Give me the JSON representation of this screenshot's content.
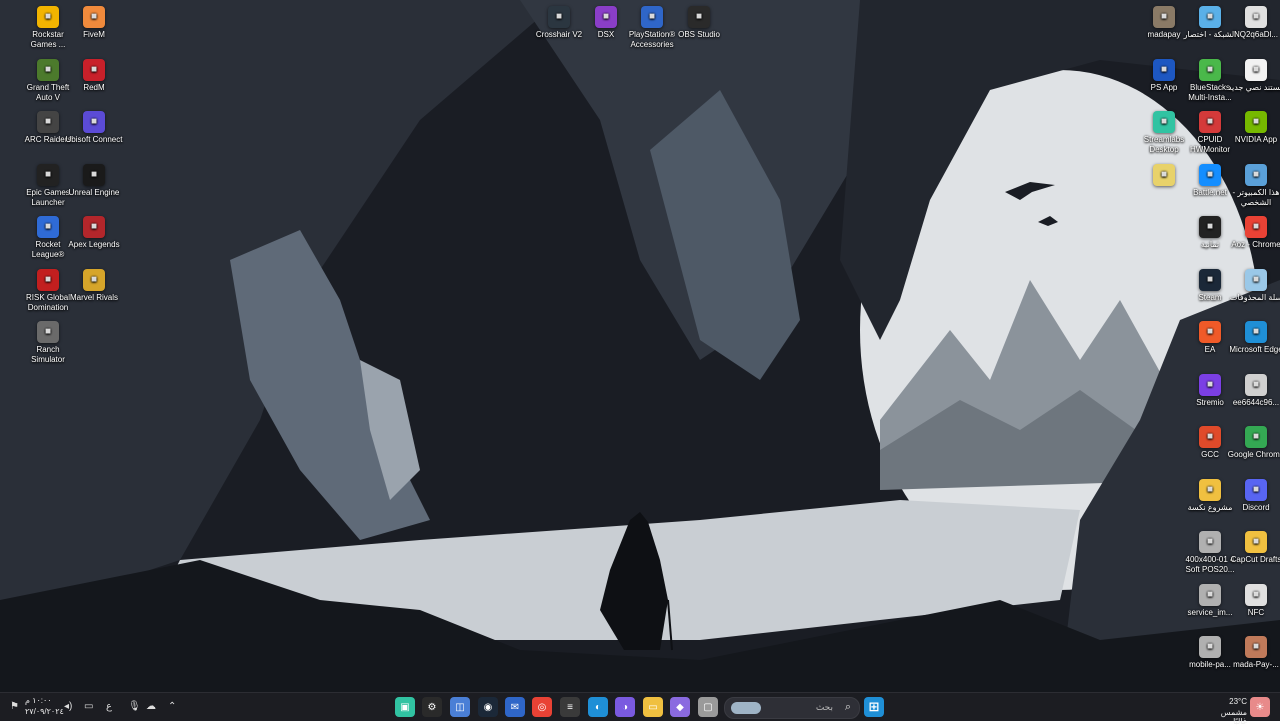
{
  "colors": {
    "taskbar": "#1c1d22",
    "sky": "#e6e8ea",
    "cave_dark": "#1a1d24"
  },
  "desktop_icons": [
    {
      "id": "rockstar",
      "label": "Rockstar Games ...",
      "icon": "rockstar-icon",
      "color": "#f2b400"
    },
    {
      "id": "fivem",
      "label": "FiveM",
      "icon": "fivem-icon",
      "color": "#f08a3c"
    },
    {
      "id": "gta",
      "label": "Grand Theft Auto V",
      "icon": "gta-icon",
      "color": "#4c7a2c"
    },
    {
      "id": "redm",
      "label": "RedM",
      "icon": "redm-icon",
      "color": "#c8202a"
    },
    {
      "id": "arc",
      "label": "ARC Raiders",
      "icon": "arc-raiders-icon",
      "color": "#444444"
    },
    {
      "id": "ubisoft",
      "label": "Ubisoft Connect",
      "icon": "ubisoft-icon",
      "color": "#5b4bd6"
    },
    {
      "id": "epic",
      "label": "Epic Games Launcher",
      "icon": "epic-games-icon",
      "color": "#222222"
    },
    {
      "id": "unreal",
      "label": "Unreal Engine",
      "icon": "unreal-engine-icon",
      "color": "#1a1a1a"
    },
    {
      "id": "rocket",
      "label": "Rocket League®",
      "icon": "rocket-league-icon",
      "color": "#2f6bd6"
    },
    {
      "id": "apex",
      "label": "Apex Legends",
      "icon": "apex-legends-icon",
      "color": "#b3262b"
    },
    {
      "id": "risk",
      "label": "RISK Global Domination",
      "icon": "risk-icon",
      "color": "#c21f1f"
    },
    {
      "id": "marvel",
      "label": "Marvel Rivals",
      "icon": "marvel-rivals-icon",
      "color": "#d6a52a"
    },
    {
      "id": "ranch",
      "label": "Ranch Simulator",
      "icon": "ranch-simulator-icon",
      "color": "#6a6a6a"
    },
    {
      "id": "crosshair",
      "label": "Crosshair V2",
      "icon": "crosshair-icon",
      "color": "#2b3640"
    },
    {
      "id": "dsx",
      "label": "DSX",
      "icon": "dsx-icon",
      "color": "#8a3ec8"
    },
    {
      "id": "ps_acc",
      "label": "PlayStation® Accessories",
      "icon": "playstation-accessories-icon",
      "color": "#2f66c8"
    },
    {
      "id": "obs",
      "label": "OBS Studio",
      "icon": "obs-studio-icon",
      "color": "#2a2a2a"
    },
    {
      "id": "madapay",
      "label": "madapay",
      "icon": "madapay-icon",
      "color": "#8a7a66"
    },
    {
      "id": "network",
      "label": "الشبكة - اختصار",
      "icon": "network-shortcut-icon",
      "color": "#5ab0e8"
    },
    {
      "id": "nq",
      "label": "NQ2q6aDl...",
      "icon": "file-icon",
      "color": "#e0e0e0"
    },
    {
      "id": "psapp",
      "label": "PS App",
      "icon": "ps-app-icon",
      "color": "#1d57c1"
    },
    {
      "id": "bluestacks",
      "label": "BlueStacks Multi-Insta...",
      "icon": "bluestacks-icon",
      "color": "#4ab84a"
    },
    {
      "id": "newdoc",
      "label": "مستند نصي جديد",
      "icon": "text-document-icon",
      "color": "#f2f2f2"
    },
    {
      "id": "streamlabs",
      "label": "Streamlabs Desktop",
      "icon": "streamlabs-icon",
      "color": "#31c3a2"
    },
    {
      "id": "cpuid",
      "label": "CPUID HWMonitor",
      "icon": "hwmonitor-icon",
      "color": "#d43a3a"
    },
    {
      "id": "nvidia",
      "label": "NVIDIA App",
      "icon": "nvidia-icon",
      "color": "#76b900"
    },
    {
      "id": "notepad",
      "label": "",
      "icon": "notepad-icon",
      "color": "#e8d26a"
    },
    {
      "id": "battlenet",
      "label": "Battle.net",
      "icon": "battlenet-icon",
      "color": "#148eff"
    },
    {
      "id": "thispc",
      "label": "هذا الكمبيوتر - الشخصي",
      "icon": "this-pc-icon",
      "color": "#5aa0d8"
    },
    {
      "id": "thamania",
      "label": "ثمانية",
      "icon": "thamania-icon",
      "color": "#222222"
    },
    {
      "id": "aoz",
      "label": "Aoz - Chrome",
      "icon": "chrome-icon",
      "color": "#e94235"
    },
    {
      "id": "steam",
      "label": "Steam",
      "icon": "steam-icon",
      "color": "#1b2838"
    },
    {
      "id": "recycle",
      "label": "سلة المحذوفات",
      "icon": "recycle-bin-icon",
      "color": "#9ac8e8"
    },
    {
      "id": "ea",
      "label": "EA",
      "icon": "ea-icon",
      "color": "#f05a28"
    },
    {
      "id": "edge",
      "label": "Microsoft Edge",
      "icon": "edge-icon",
      "color": "#1f8fd6"
    },
    {
      "id": "stremio",
      "label": "Stremio",
      "icon": "stremio-icon",
      "color": "#7b3fe4"
    },
    {
      "id": "ee6644",
      "label": "ee6644c96...",
      "icon": "file-icon",
      "color": "#d0d0d0"
    },
    {
      "id": "gcc",
      "label": "GCC",
      "icon": "gcc-icon",
      "color": "#e04a2a"
    },
    {
      "id": "gchrome",
      "label": "Google Chrome",
      "icon": "chrome-icon",
      "color": "#34a853"
    },
    {
      "id": "project",
      "label": "مشروع نكسة",
      "icon": "folder-icon",
      "color": "#f0c040"
    },
    {
      "id": "discord",
      "label": "Discord",
      "icon": "discord-icon",
      "color": "#5865f2"
    },
    {
      "id": "soft",
      "label": "400x400-01 4 Soft POS20...",
      "icon": "image-file-icon",
      "color": "#b0b0b0"
    },
    {
      "id": "capcut",
      "label": "CapCut Drafts",
      "icon": "folder-icon",
      "color": "#f0c040"
    },
    {
      "id": "service",
      "label": "service_im...",
      "icon": "image-file-icon",
      "color": "#b0b0b0"
    },
    {
      "id": "nfc",
      "label": "NFC",
      "icon": "file-icon",
      "color": "#e0e0e0"
    },
    {
      "id": "mobilepa",
      "label": "mobile-pa...",
      "icon": "image-file-icon",
      "color": "#b0b0b0"
    },
    {
      "id": "madapay2",
      "label": "mada-Pay-...",
      "icon": "image-file-icon",
      "color": "#c07a5a"
    }
  ],
  "taskbar": {
    "search_placeholder": "بحث",
    "clock_time": "١٠:٠٠ م",
    "clock_date": "٢٧/٠٩/٢٠٢٤",
    "language": "ع",
    "weather_temp": "23°C",
    "weather_desc": "مشمس غالبًا",
    "apps": [
      {
        "name": "streamlabs-task",
        "color": "#31c3a2",
        "glyph": "▣"
      },
      {
        "name": "settings-task",
        "color": "#2a2a2a",
        "glyph": "⚙"
      },
      {
        "name": "app-task-blue",
        "color": "#4a7fd6",
        "glyph": "◫"
      },
      {
        "name": "steam-task",
        "color": "#1b2838",
        "glyph": "◉"
      },
      {
        "name": "mail-task",
        "color": "#2f66c8",
        "glyph": "✉"
      },
      {
        "name": "chrome-task",
        "color": "#e94235",
        "glyph": "◎"
      },
      {
        "name": "notes-task",
        "color": "#3a3a3a",
        "glyph": "≡"
      },
      {
        "name": "edge-task",
        "color": "#1f8fd6",
        "glyph": "◐"
      },
      {
        "name": "discord-task",
        "color": "#7a5ae0",
        "glyph": "◑"
      },
      {
        "name": "explorer-task",
        "color": "#f0c040",
        "glyph": "▭"
      },
      {
        "name": "copilot-task",
        "color": "#8a6ae0",
        "glyph": "◆"
      },
      {
        "name": "window-task",
        "color": "#9a9a9a",
        "glyph": "▢"
      }
    ]
  }
}
